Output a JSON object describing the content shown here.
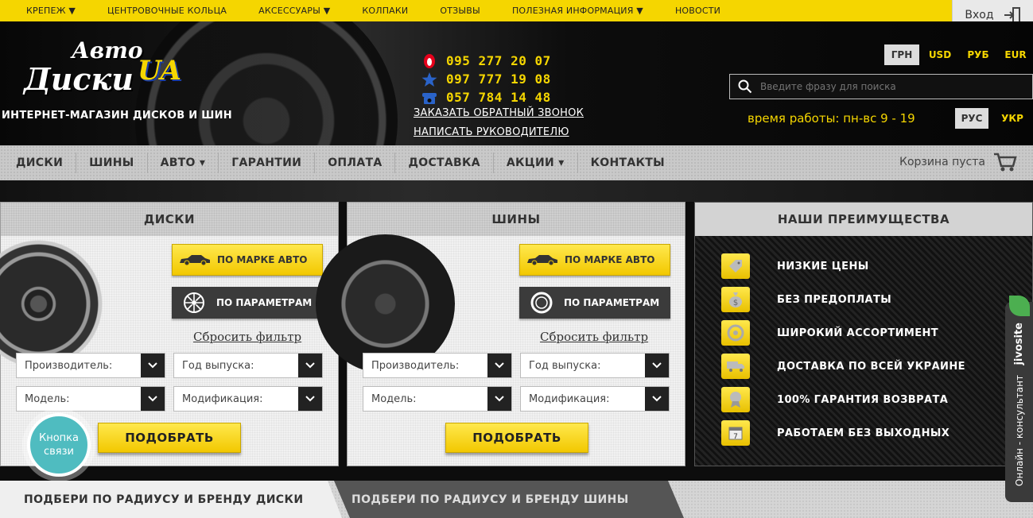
{
  "topmenu": [
    {
      "label": "КРЕПЕЖ ▼"
    },
    {
      "label": "ЦЕНТРОВОЧНЫЕ КОЛЬЦА"
    },
    {
      "label": "АКСЕССУАРЫ ▼"
    },
    {
      "label": "КОЛПАКИ"
    },
    {
      "label": "ОТЗЫВЫ"
    },
    {
      "label": "ПОЛЕЗНАЯ ИНФОРМАЦИЯ ▼"
    },
    {
      "label": "НОВОСТИ"
    }
  ],
  "login": {
    "label": "Вход"
  },
  "logo": {
    "line1": "Авто",
    "line2": "Диски",
    "line3": "UA"
  },
  "tagline": "ИНТЕРНЕТ-МАГАЗИН ДИСКОВ И ШИН",
  "phones": [
    {
      "operator": "mts-icon",
      "number": "095 277 20 07",
      "color": "#e5001b"
    },
    {
      "operator": "kyivstar-icon",
      "number": "097 777 19 08",
      "color": "#2a63c9"
    },
    {
      "operator": "landline-icon",
      "number": "057 784 14 48",
      "color": "#2a63c9"
    }
  ],
  "links": {
    "callback": "ЗАКАЗАТЬ ОБРАТНЫЙ ЗВОНОК",
    "write_manager": "НАПИСАТЬ РУКОВОДИТЕЛЮ"
  },
  "currencies": [
    {
      "label": "ГРН",
      "active": true
    },
    {
      "label": "USD",
      "active": false
    },
    {
      "label": "РУБ",
      "active": false
    },
    {
      "label": "EUR",
      "active": false
    }
  ],
  "search": {
    "placeholder": "Введите фразу для поиска"
  },
  "hours": "время работы: пн-вс 9 - 19",
  "languages": [
    {
      "label": "РУС",
      "active": true
    },
    {
      "label": "УКР",
      "active": false
    }
  ],
  "nav": [
    {
      "label": "ДИСКИ"
    },
    {
      "label": "ШИНЫ"
    },
    {
      "label": "АВТО ▾"
    },
    {
      "label": "ГАРАНТИИ"
    },
    {
      "label": "ОПЛАТА"
    },
    {
      "label": "ДОСТАВКА"
    },
    {
      "label": "АКЦИИ ▾"
    },
    {
      "label": "КОНТАКТЫ"
    }
  ],
  "cart": {
    "label": "Корзина пуста"
  },
  "panels": {
    "disks": {
      "title": "ДИСКИ",
      "by_car": "ПО МАРКЕ АВТО",
      "by_params": "ПО ПАРАМЕТРАМ",
      "reset": "Сбросить фильтр",
      "manufacturer": "Производитель:",
      "year": "Год выпуска:",
      "model": "Модель:",
      "modification": "Модификация:",
      "pick": "ПОДОБРАТЬ"
    },
    "tires": {
      "title": "ШИНЫ",
      "by_car": "ПО МАРКЕ АВТО",
      "by_params": "ПО ПАРАМЕТРАМ",
      "reset": "Сбросить фильтр",
      "manufacturer": "Производитель:",
      "year": "Год выпуска:",
      "model": "Модель:",
      "modification": "Модификация:",
      "pick": "ПОДОБРАТЬ"
    },
    "advantages": {
      "title": "НАШИ ПРЕИМУЩЕСТВА",
      "items": [
        {
          "icon": "price-tag-icon",
          "label": "НИЗКИЕ ЦЕНЫ"
        },
        {
          "icon": "money-bag-icon",
          "label": "БЕЗ ПРЕДОПЛАТЫ"
        },
        {
          "icon": "wheel-icon",
          "label": "ШИРОКИЙ АССОРТИМЕНТ"
        },
        {
          "icon": "truck-icon",
          "label": "ДОСТАВКА ПО ВСЕЙ УКРАИНЕ"
        },
        {
          "icon": "medal-icon",
          "label": "100% ГАРАНТИЯ ВОЗВРАТА"
        },
        {
          "icon": "calendar-icon",
          "label": "РАБОТАЕМ БЕЗ ВЫХОДНЫХ"
        }
      ]
    }
  },
  "callback_widget": {
    "line1": "Кнопка",
    "line2": "связи"
  },
  "jivo": {
    "brand": "jivosite",
    "label": "Онлайн - консультант"
  },
  "bottom_tabs": [
    {
      "label": "ПОДБЕРИ ПО РАДИУСУ И БРЕНДУ ДИСКИ",
      "active": true
    },
    {
      "label": "ПОДБЕРИ ПО РАДИУСУ И БРЕНДУ ШИНЫ",
      "active": false
    }
  ],
  "colors": {
    "accent": "#f5d600",
    "dark": "#3b3b3b",
    "callback": "#4fbcc0"
  }
}
